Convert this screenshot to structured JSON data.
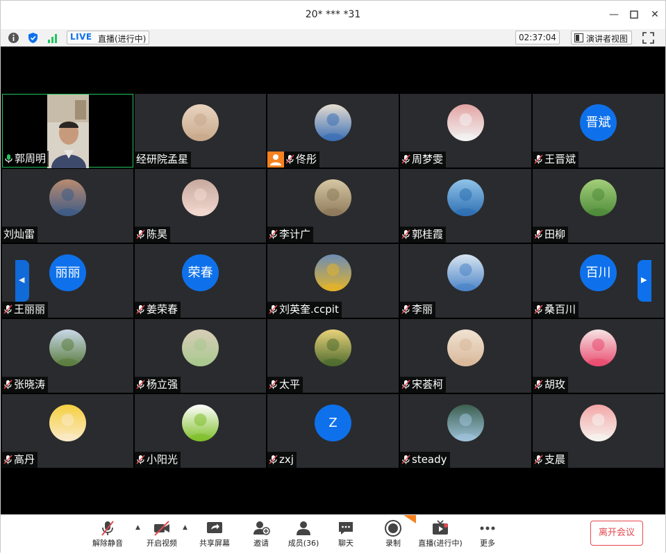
{
  "window": {
    "title": "20* *** *31"
  },
  "status": {
    "live_tag": "LIVE",
    "live_text": "直播(进行中)",
    "timer": "02:37:04",
    "speaker_view": "演讲者视图"
  },
  "participants": [
    {
      "name": "郭周明",
      "type": "video",
      "active": true,
      "mic": "on"
    },
    {
      "name": "经研院孟星",
      "type": "photo",
      "mic": "none",
      "colors": [
        "#c9a98c",
        "#e8d4c0"
      ]
    },
    {
      "name": "佟彤",
      "type": "photo",
      "mic": "muted",
      "host": true,
      "colors": [
        "#3b6fb5",
        "#e6ddd0"
      ]
    },
    {
      "name": "周梦雯",
      "type": "photo",
      "mic": "muted",
      "colors": [
        "#f3f3f3",
        "#e3a3a3"
      ]
    },
    {
      "name": "王晋斌",
      "type": "text",
      "avatar_text": "晋斌",
      "mic": "muted"
    },
    {
      "name": "刘灿雷",
      "type": "photo",
      "mic": "none",
      "colors": [
        "#3d5b86",
        "#b98b70"
      ]
    },
    {
      "name": "陈昊",
      "type": "photo",
      "mic": "muted",
      "colors": [
        "#f2d9cf",
        "#c8a9a0"
      ]
    },
    {
      "name": "李计广",
      "type": "photo",
      "mic": "muted",
      "colors": [
        "#8d7a5a",
        "#d6c7a4"
      ]
    },
    {
      "name": "郭桂霞",
      "type": "photo",
      "mic": "muted",
      "colors": [
        "#2e6fb3",
        "#8fc3e8"
      ]
    },
    {
      "name": "田柳",
      "type": "photo",
      "mic": "muted",
      "colors": [
        "#4e8b3a",
        "#a4cf7a"
      ]
    },
    {
      "name": "王丽丽",
      "type": "text",
      "avatar_text": "丽丽",
      "mic": "muted"
    },
    {
      "name": "姜荣春",
      "type": "text",
      "avatar_text": "荣春",
      "mic": "muted"
    },
    {
      "name": "刘英奎.ccpit",
      "type": "photo",
      "mic": "muted",
      "colors": [
        "#e3b32a",
        "#6d8db4"
      ]
    },
    {
      "name": "李丽",
      "type": "photo",
      "mic": "muted",
      "colors": [
        "#4a84c7",
        "#d9e5f0"
      ]
    },
    {
      "name": "桑百川",
      "type": "text",
      "avatar_text": "百川",
      "mic": "muted"
    },
    {
      "name": "张晓涛",
      "type": "photo",
      "mic": "muted",
      "colors": [
        "#5b7d3e",
        "#c9d8e8"
      ]
    },
    {
      "name": "杨立强",
      "type": "photo",
      "mic": "muted",
      "colors": [
        "#a8c88e",
        "#d8cdb8"
      ]
    },
    {
      "name": "太平",
      "type": "photo",
      "mic": "muted",
      "colors": [
        "#4d6b2e",
        "#e8d27a"
      ]
    },
    {
      "name": "宋荟柯",
      "type": "photo",
      "mic": "muted",
      "colors": [
        "#d8b89a",
        "#f0e2d2"
      ]
    },
    {
      "name": "胡玫",
      "type": "photo",
      "mic": "muted",
      "colors": [
        "#e94b6f",
        "#f6e3e3"
      ]
    },
    {
      "name": "高丹",
      "type": "photo",
      "mic": "muted",
      "colors": [
        "#fbe9c8",
        "#f4d03f"
      ]
    },
    {
      "name": "小阳光",
      "type": "photo",
      "mic": "muted",
      "colors": [
        "#7fbf2a",
        "#ffffff"
      ]
    },
    {
      "name": "zxj",
      "type": "text",
      "avatar_text": "Z",
      "mic": "muted"
    },
    {
      "name": "steady",
      "type": "photo",
      "mic": "muted",
      "colors": [
        "#9ec3da",
        "#3c5f4f"
      ]
    },
    {
      "name": "支晨",
      "type": "photo",
      "mic": "muted",
      "colors": [
        "#f6f2ee",
        "#f2a6a6"
      ]
    }
  ],
  "toolbar": {
    "unmute": "解除静音",
    "start_video": "开启视频",
    "share": "共享屏幕",
    "invite": "邀请",
    "members": "成员(36)",
    "chat": "聊天",
    "record": "录制",
    "live": "直播(进行中)",
    "more": "更多",
    "leave": "离开会议"
  },
  "colors": {
    "accent": "#0e71eb",
    "tile_bg": "#2a2b2e",
    "muted_red": "#e5484d",
    "active_green": "#22c55e"
  }
}
